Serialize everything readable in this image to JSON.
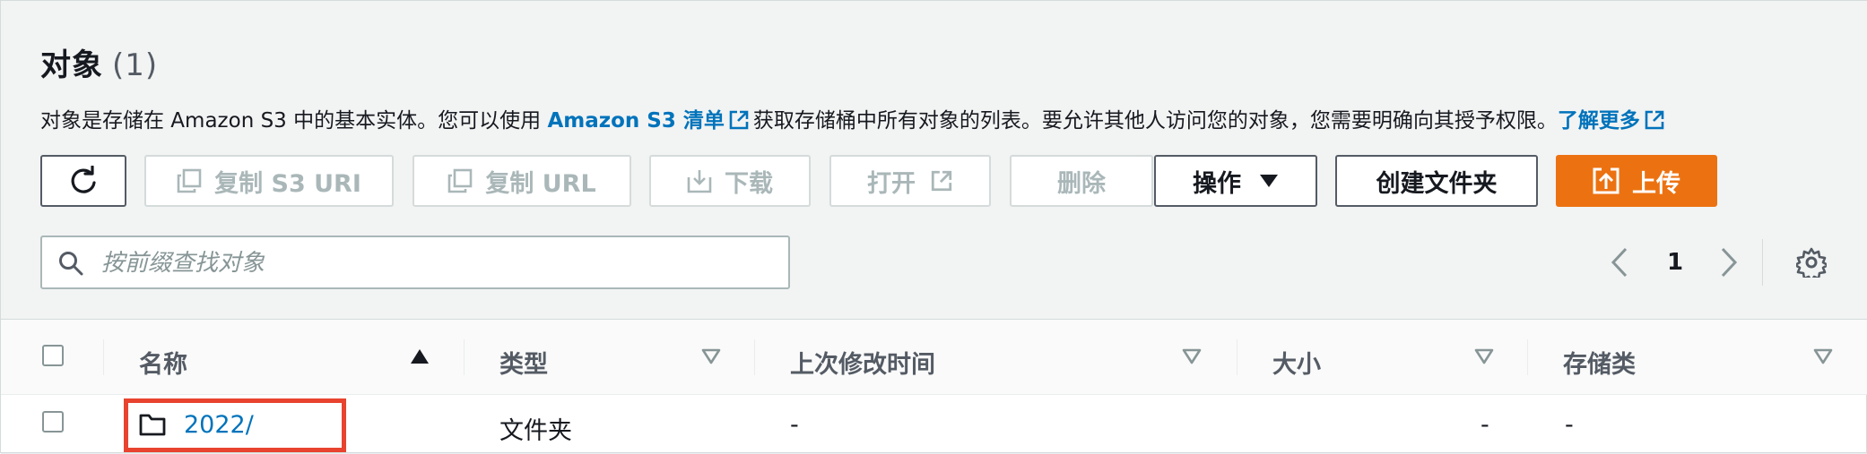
{
  "header": {
    "title": "对象",
    "count": "(1)",
    "desc_prefix": "对象是存储在 Amazon S3 中的基本实体。您可以使用 ",
    "desc_link1": "Amazon S3 清单",
    "desc_middle": "获取存储桶中所有对象的列表。要允许其他人访问您的对象，您需要明确向其授予权限。",
    "desc_link2": "了解更多"
  },
  "toolbar": {
    "copy_s3_uri": "复制 S3 URI",
    "copy_url": "复制 URL",
    "download": "下载",
    "open": "打开",
    "delete": "删除",
    "actions": "操作",
    "create_folder": "创建文件夹",
    "upload": "上传"
  },
  "search": {
    "placeholder": "按前缀查找对象"
  },
  "pagination": {
    "current_page": "1"
  },
  "table": {
    "columns": [
      "名称",
      "类型",
      "上次修改时间",
      "大小",
      "存储类"
    ],
    "rows": [
      {
        "name": "2022/",
        "type": "文件夹",
        "last_modified": "-",
        "size": "-",
        "storage_class": "-"
      }
    ]
  },
  "colors": {
    "primary": "#ec7211",
    "link": "#0073bb",
    "highlight": "#e8432f"
  }
}
